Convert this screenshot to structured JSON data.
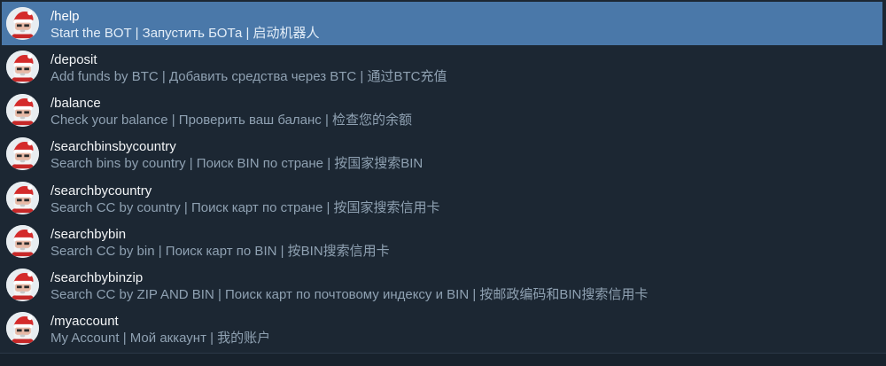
{
  "commands": [
    {
      "name": "/help",
      "description": "Start the BOT | Запустить БОТа | 启动机器人",
      "selected": true
    },
    {
      "name": "/deposit",
      "description": "Add funds by BTC | Добавить средства через BTC | 通过BTC充值",
      "selected": false
    },
    {
      "name": "/balance",
      "description": "Check your balance | Проверить ваш баланс | 检查您的余额",
      "selected": false
    },
    {
      "name": "/searchbinsbycountry",
      "description": "Search bins by country | Поиск BIN по стране | 按国家搜索BIN",
      "selected": false
    },
    {
      "name": "/searchbycountry",
      "description": "Search CC by country | Поиск карт по стране | 按国家搜索信用卡",
      "selected": false
    },
    {
      "name": "/searchbybin",
      "description": "Search CC by bin | Поиск карт по BIN | 按BIN搜索信用卡",
      "selected": false
    },
    {
      "name": "/searchbybinzip",
      "description": "Search CC by ZIP AND BIN | Поиск карт по почтовому индексу и BIN | 按邮政编码和BIN搜索信用卡",
      "selected": false
    },
    {
      "name": "/myaccount",
      "description": "My Account | Мой аккаунт | 我的账户",
      "selected": false
    }
  ],
  "colors": {
    "background": "#1c2733",
    "selected_row": "#4a78a9",
    "command_text": "#f2f4f6",
    "description_text": "#8fa1b2"
  },
  "icons": {
    "avatar": "santa-bot-avatar-icon"
  }
}
